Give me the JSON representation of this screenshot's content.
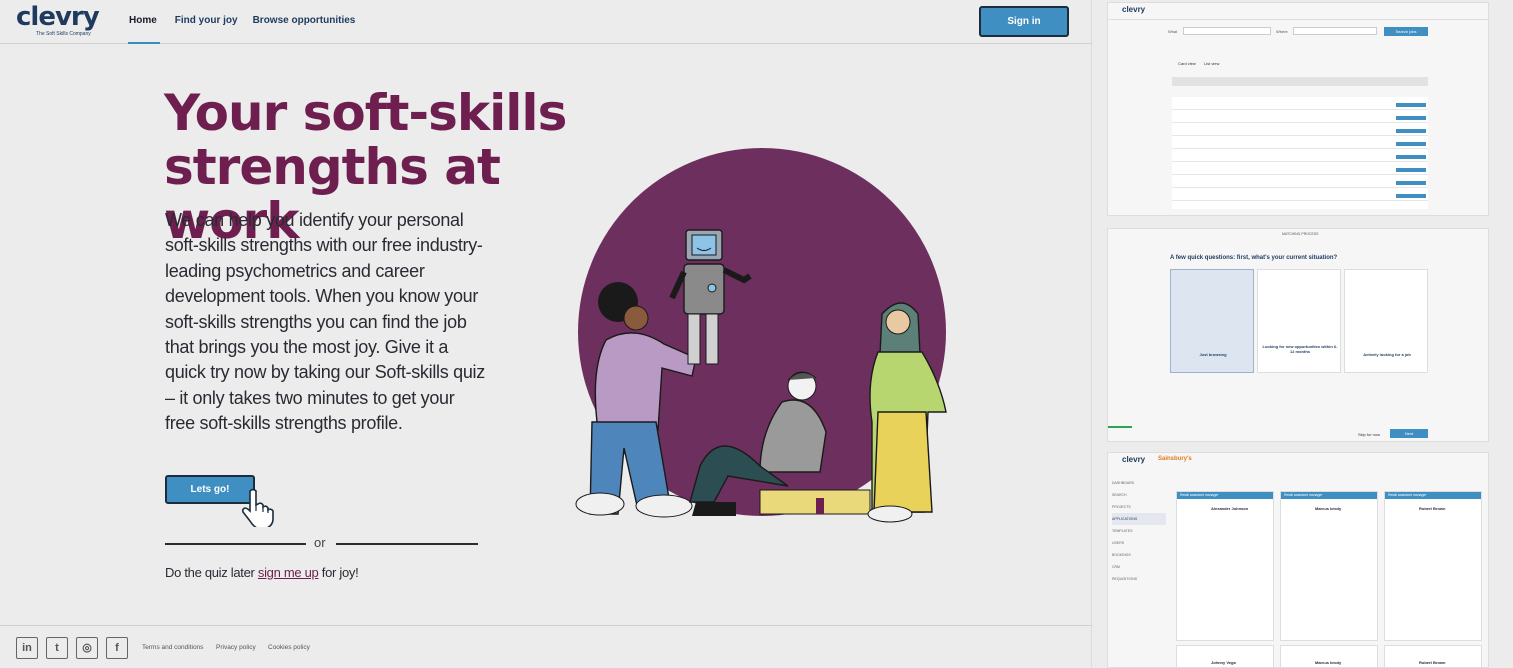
{
  "header": {
    "logo": {
      "word": "clevry",
      "tagline": "The Soft Skills Company"
    },
    "nav": [
      {
        "label": "Home",
        "active": true
      },
      {
        "label": "Find your joy",
        "active": false
      },
      {
        "label": "Browse opportunities",
        "active": false
      }
    ],
    "signin_label": "Sign in"
  },
  "hero": {
    "title": "Your soft-skills strengths at work",
    "body": "We can help you identify your personal soft-skills strengths with our free industry-leading psychometrics and career development tools. When you know your soft-skills strengths you can find the job that brings you the most joy. Give it a quick try now by taking our Soft-skills quiz – it only takes two minutes to get your free soft-skills strengths profile.",
    "cta_label": "Lets go!",
    "or_label": "or",
    "later_prefix": "Do the quiz later ",
    "later_link": "sign me up",
    "later_suffix": " for joy!"
  },
  "footer": {
    "social": [
      {
        "icon": "linkedin-icon",
        "glyph": "in"
      },
      {
        "icon": "twitter-icon",
        "glyph": "t"
      },
      {
        "icon": "instagram-icon",
        "glyph": "◎"
      },
      {
        "icon": "facebook-icon",
        "glyph": "f"
      }
    ],
    "links": [
      "Terms and conditions",
      "Privacy policy",
      "Cookies policy"
    ]
  },
  "previews": {
    "browse": {
      "logo": "clevry",
      "what_label": "What",
      "where_label": "Where",
      "search_label": "Search jobs",
      "card_view": "Card view",
      "list_view": "List view"
    },
    "quiz": {
      "heading_small": "MATCHING PROCESS",
      "question": "A few quick questions: first, what's your current situation?",
      "options": [
        "Just browsing",
        "Looking for new opportunities within 6-12 months",
        "Actively looking for a job"
      ],
      "skip_label": "Skip for now",
      "next_label": "Next"
    },
    "dashboard": {
      "logo": "clevry",
      "brand": "Sainsbury's",
      "sidebar": [
        "DASHBOARD",
        "SEARCH",
        "PROJECTS",
        "APPLICATIONS",
        "TEMPLATES",
        "USERS",
        "BOOKINGS",
        "CRM",
        "REQUISITIONS"
      ],
      "candidates": [
        "Alexander Johnson",
        "Marcus brody",
        "Robert Brown"
      ],
      "candidates_row2": [
        "Johnny Vega",
        "Marcus brody",
        "Robert Brown"
      ],
      "card_title": "Retail assistant manager"
    }
  },
  "colors": {
    "brand_plum": "#6e1f4f",
    "brand_blue": "#3f8fc2",
    "navy": "#1e3a5f"
  }
}
